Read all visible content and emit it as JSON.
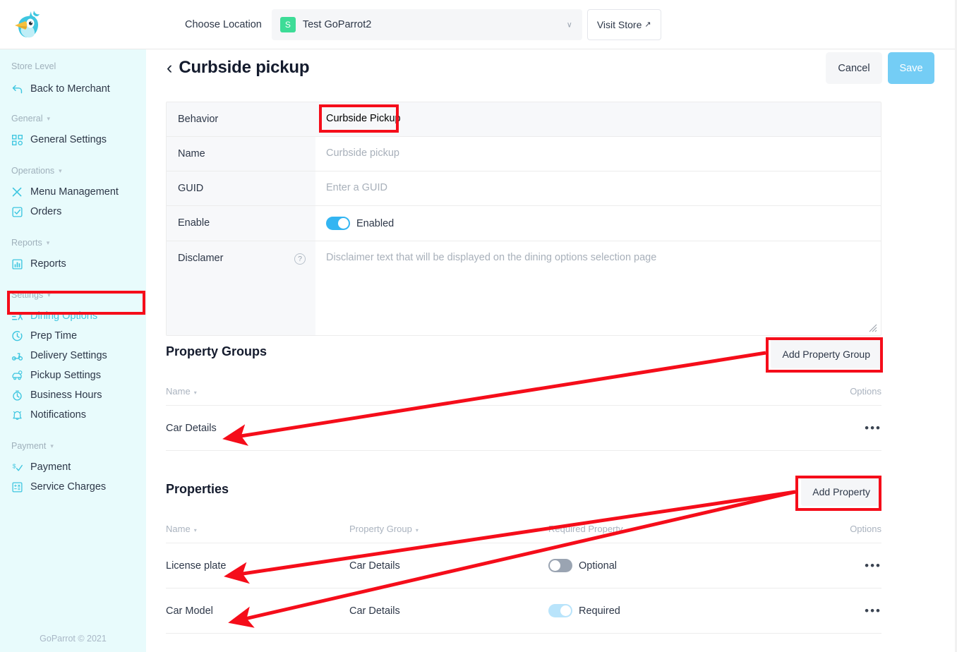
{
  "topbar": {
    "logo_alt": "GoParrot parrot logo",
    "choose_location_label": "Choose Location",
    "location_badge": "S",
    "location_name": "Test GoParrot2",
    "visit_store_label": "Visit Store",
    "visit_store_arrow": "↗",
    "caret": "∨"
  },
  "sidebar": {
    "groups": [
      {
        "label": "Store Level",
        "collapsible": false,
        "items": [
          {
            "label": "Back to Merchant",
            "icon": "back-arrow-icon",
            "active": false
          }
        ]
      },
      {
        "label": "General",
        "collapsible": true,
        "items": [
          {
            "label": "General Settings",
            "icon": "grid-squares-icon",
            "active": false
          }
        ]
      },
      {
        "label": "Operations",
        "collapsible": true,
        "items": [
          {
            "label": "Menu Management",
            "icon": "cutlery-icon",
            "active": false
          },
          {
            "label": "Orders",
            "icon": "checkbox-square-icon",
            "active": false
          }
        ]
      },
      {
        "label": "Reports",
        "collapsible": true,
        "items": [
          {
            "label": "Reports",
            "icon": "bar-chart-icon",
            "active": false
          }
        ]
      },
      {
        "label": "Settings",
        "collapsible": true,
        "items": [
          {
            "label": "Dining Options",
            "icon": "dining-options-icon",
            "active": true
          },
          {
            "label": "Prep Time",
            "icon": "clock-icon",
            "active": false
          },
          {
            "label": "Delivery Settings",
            "icon": "scooter-icon",
            "active": false
          },
          {
            "label": "Pickup Settings",
            "icon": "car-pickup-icon",
            "active": false
          },
          {
            "label": "Business Hours",
            "icon": "stopwatch-icon",
            "active": false
          },
          {
            "label": "Notifications",
            "icon": "bell-icon",
            "active": false
          }
        ]
      },
      {
        "label": "Payment",
        "collapsible": true,
        "items": [
          {
            "label": "Payment",
            "icon": "dollar-check-icon",
            "active": false
          },
          {
            "label": "Service Charges",
            "icon": "calculator-icon",
            "active": false
          }
        ]
      }
    ],
    "footer": "GoParrot © 2021"
  },
  "page": {
    "back_chevron": "‹",
    "title": "Curbside pickup",
    "cancel_label": "Cancel",
    "save_label": "Save"
  },
  "form": {
    "rows": [
      {
        "label": "Behavior",
        "value": "Curbside Pickup",
        "type": "text",
        "highlighted": true
      },
      {
        "label": "Name",
        "value": "",
        "placeholder": "Curbside pickup",
        "type": "input"
      },
      {
        "label": "GUID",
        "value": "",
        "placeholder": "Enter a GUID",
        "type": "input"
      },
      {
        "label": "Enable",
        "toggle_state": "on",
        "toggle_label": "Enabled",
        "type": "toggle"
      },
      {
        "label": "Disclamer",
        "value": "",
        "placeholder": "Disclaimer text that will be displayed on the dining options selection page",
        "type": "textarea",
        "has_help": true,
        "help_glyph": "?"
      }
    ]
  },
  "property_groups": {
    "title": "Property Groups",
    "add_button": "Add Property Group",
    "columns": [
      "Name",
      "Options"
    ],
    "sort_caret": "▾",
    "rows": [
      {
        "name": "Car Details",
        "options": "•••"
      }
    ]
  },
  "properties": {
    "title": "Properties",
    "add_button": "Add Property",
    "columns": [
      "Name",
      "Property Group",
      "Required Property",
      "Options"
    ],
    "sort_caret": "▾",
    "rows": [
      {
        "name": "License plate",
        "group": "Car Details",
        "required_label": "Optional",
        "required_state": "off",
        "options": "•••"
      },
      {
        "name": "Car Model",
        "group": "Car Details",
        "required_label": "Required",
        "required_state": "on-light",
        "options": "•••"
      }
    ]
  },
  "colors": {
    "annotation_red": "#f50d1a",
    "sidebar_bg": "#e8fbfc",
    "accent_cyan": "#3ec6e0",
    "toggle_on_blue": "#33b5f2",
    "toggle_on_light_blue": "#b9e4fb",
    "toggle_off_gray": "#9aa4b2",
    "save_button_blue": "#74cdf5",
    "location_badge_green": "#3ddc97"
  }
}
